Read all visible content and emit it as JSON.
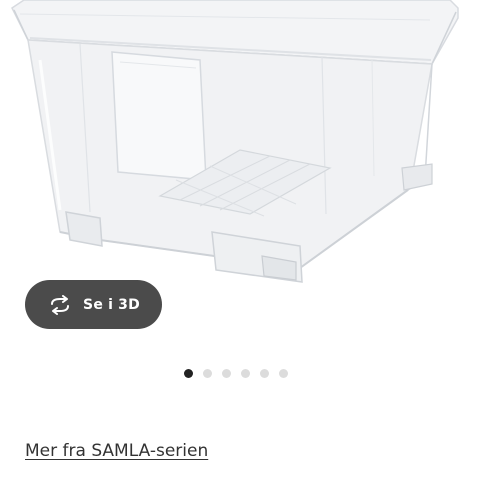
{
  "product": {
    "image_icon": "transparent-storage-box-with-lid"
  },
  "viewer": {
    "button_label": "Se i 3D",
    "button_icon": "rotate-3d-icon",
    "button_color": "#4b4b4b"
  },
  "carousel": {
    "total": 6,
    "active_index": 0
  },
  "series_link": {
    "label": "Mer fra SAMLA-serien"
  }
}
